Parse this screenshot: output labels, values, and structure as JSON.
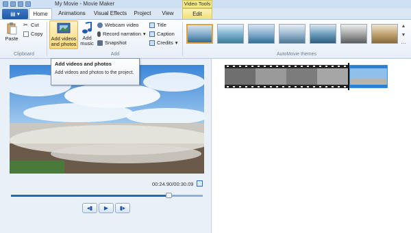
{
  "window": {
    "title": "My Movie - Movie Maker",
    "context_tab_group": "Video Tools"
  },
  "tabs": [
    {
      "label": "Home"
    },
    {
      "label": "Animations"
    },
    {
      "label": "Visual Effects"
    },
    {
      "label": "Project"
    },
    {
      "label": "View"
    },
    {
      "label": "Edit"
    }
  ],
  "ribbon": {
    "clipboard": {
      "paste": "Paste",
      "cut": "Cut",
      "copy": "Copy",
      "group_label": "Clipboard"
    },
    "add": {
      "add_videos_line1": "Add videos",
      "add_videos_line2": "and photos",
      "add_music_line1": "Add",
      "add_music_line2": "music",
      "webcam": "Webcam video",
      "narration": "Record narration",
      "snapshot": "Snapshot",
      "title": "Title",
      "caption": "Caption",
      "credits": "Credits",
      "group_label": "Add"
    },
    "themes": {
      "group_label": "AutoMovie themes",
      "count": 7
    }
  },
  "tooltip": {
    "title": "Add videos and photos",
    "body": "Add videos and photos to the project."
  },
  "player": {
    "time": "00:24.90/00:30.09",
    "progress": 0.82
  },
  "colors": {
    "accent": "#2a66b6",
    "context_tab": "#f0e07a",
    "selection": "#e0a43a"
  }
}
